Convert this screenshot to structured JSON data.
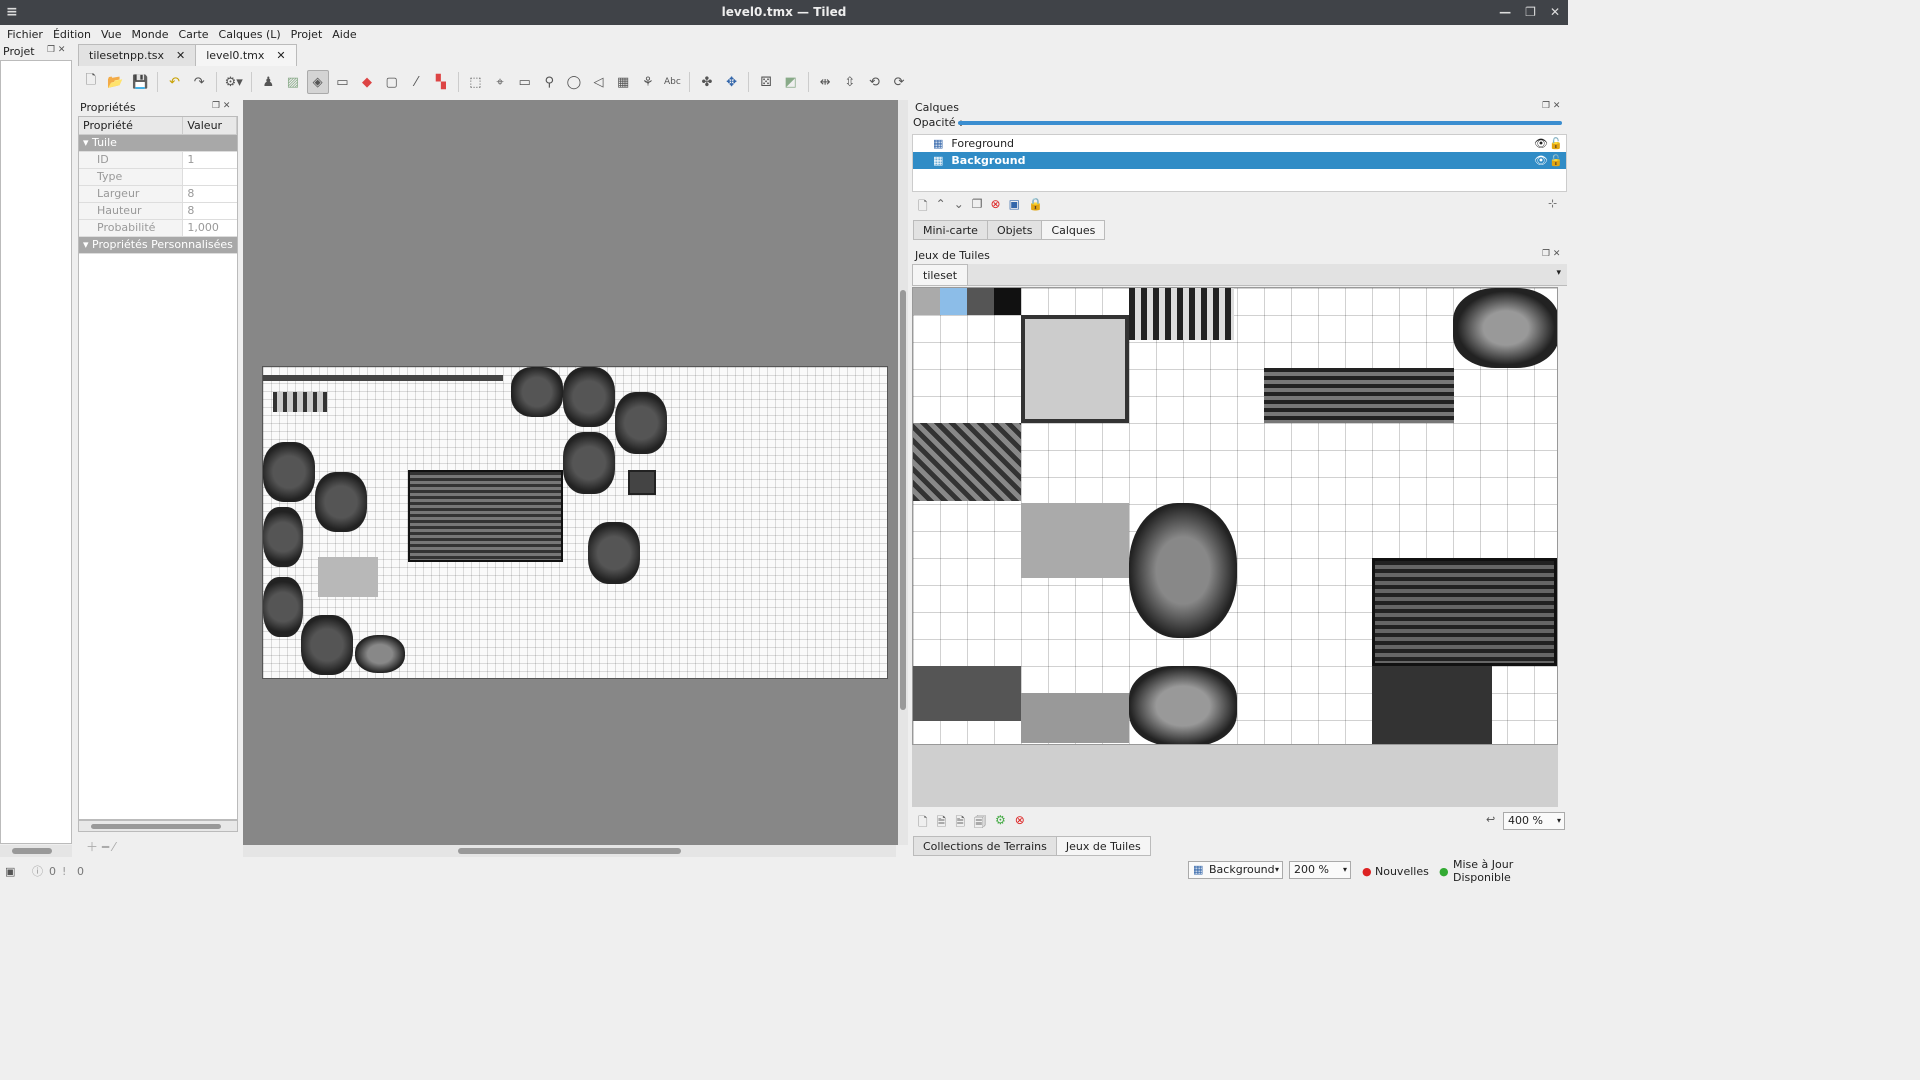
{
  "window": {
    "title": "level0.tmx — Tiled"
  },
  "menu": [
    "Fichier",
    "Édition",
    "Vue",
    "Monde",
    "Carte",
    "Calques (L)",
    "Projet",
    "Aide"
  ],
  "projet": {
    "title": "Projet"
  },
  "tabs": [
    {
      "label": "tilesetnpp.tsx"
    },
    {
      "label": "level0.tmx"
    }
  ],
  "properties": {
    "title": "Propriétés",
    "col_property": "Propriété",
    "col_value": "Valeur",
    "group1": "Tuile",
    "rows": [
      {
        "k": "ID",
        "v": "1"
      },
      {
        "k": "Type",
        "v": ""
      },
      {
        "k": "Largeur",
        "v": "8"
      },
      {
        "k": "Hauteur",
        "v": "8"
      },
      {
        "k": "Probabilité",
        "v": "1,000"
      }
    ],
    "group2": "Propriétés Personnalisées"
  },
  "layers": {
    "title": "Calques",
    "opacity_label": "Opacité :",
    "items": [
      {
        "name": "Foreground",
        "selected": false
      },
      {
        "name": "Background",
        "selected": true
      }
    ]
  },
  "dock_tabs": [
    "Mini-carte",
    "Objets",
    "Calques"
  ],
  "tilesets": {
    "title": "Jeux de Tuiles",
    "tab": "tileset",
    "zoom": "400 %"
  },
  "bottom_tabs": [
    "Collections de Terrains",
    "Jeux de Tuiles"
  ],
  "status": {
    "errors": "0",
    "warnings": "0",
    "layer": "Background",
    "zoom": "200 %",
    "news": "Nouvelles",
    "update": "Mise à Jour Disponible"
  }
}
